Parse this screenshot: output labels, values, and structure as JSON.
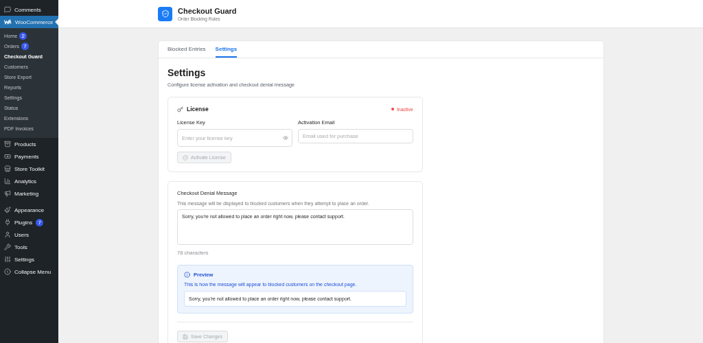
{
  "sidebar": {
    "sections": [
      {
        "items": [
          {
            "label": "Comments",
            "selected": false
          },
          {
            "label": "WooCommerce",
            "selected": true,
            "children": [
              {
                "label": "Home",
                "badge": "2",
                "selected": false
              },
              {
                "label": "Orders",
                "badge": "7",
                "selected": false
              },
              {
                "label": "Checkout Guard",
                "selected": true
              },
              {
                "label": "Customers",
                "selected": false
              },
              {
                "label": "Store Export",
                "selected": false
              },
              {
                "label": "Reports",
                "selected": false
              },
              {
                "label": "Settings",
                "selected": false
              },
              {
                "label": "Status",
                "selected": false
              },
              {
                "label": "Extensions",
                "selected": false
              },
              {
                "label": "PDF Invoices",
                "selected": false
              }
            ]
          },
          {
            "label": "Products",
            "selected": false
          },
          {
            "label": "Payments",
            "selected": false
          },
          {
            "label": "Store Toolkit",
            "selected": false
          },
          {
            "label": "Analytics",
            "selected": false
          },
          {
            "label": "Marketing",
            "selected": false
          }
        ]
      },
      {
        "items": [
          {
            "label": "Appearance",
            "selected": false
          },
          {
            "label": "Plugins",
            "badge": "7",
            "selected": false
          },
          {
            "label": "Users",
            "selected": false
          },
          {
            "label": "Tools",
            "selected": false
          },
          {
            "label": "Settings",
            "selected": false
          },
          {
            "label": "Collapse Menu",
            "selected": false
          }
        ]
      }
    ]
  },
  "header": {
    "title": "Checkout Guard",
    "subtitle": "Order Blocking Rules"
  },
  "tabs": [
    {
      "label": "Blocked Entries",
      "selected": false
    },
    {
      "label": "Settings",
      "selected": true
    }
  ],
  "settings": {
    "heading": "Settings",
    "description": "Configure license activation and checkout denial message",
    "license": {
      "title": "License",
      "status": {
        "label": "Inactive",
        "active": false
      },
      "fields": [
        {
          "label": "License Key",
          "placeholder": "Enter your license key",
          "kind": "password"
        },
        {
          "label": "Activation Email",
          "placeholder": "Email used for purchase",
          "kind": "email"
        }
      ],
      "button": {
        "label": "Activate License",
        "disabled": true
      }
    },
    "denial": {
      "title": "Checkout Denial Message",
      "description": "This message will be displayed to blocked customers when they attempt to place an order.",
      "value": "Sorry, you're not allowed to place an order right now, please contact support.",
      "char_count": "78 characters",
      "preview": {
        "title": "Preview",
        "description": "This is how the message will appear to blocked customers on the checkout page.",
        "text": "Sorry, you're not allowed to place an order right now, please contact support."
      },
      "save_button": {
        "label": "Save Changes",
        "disabled": true
      }
    }
  }
}
